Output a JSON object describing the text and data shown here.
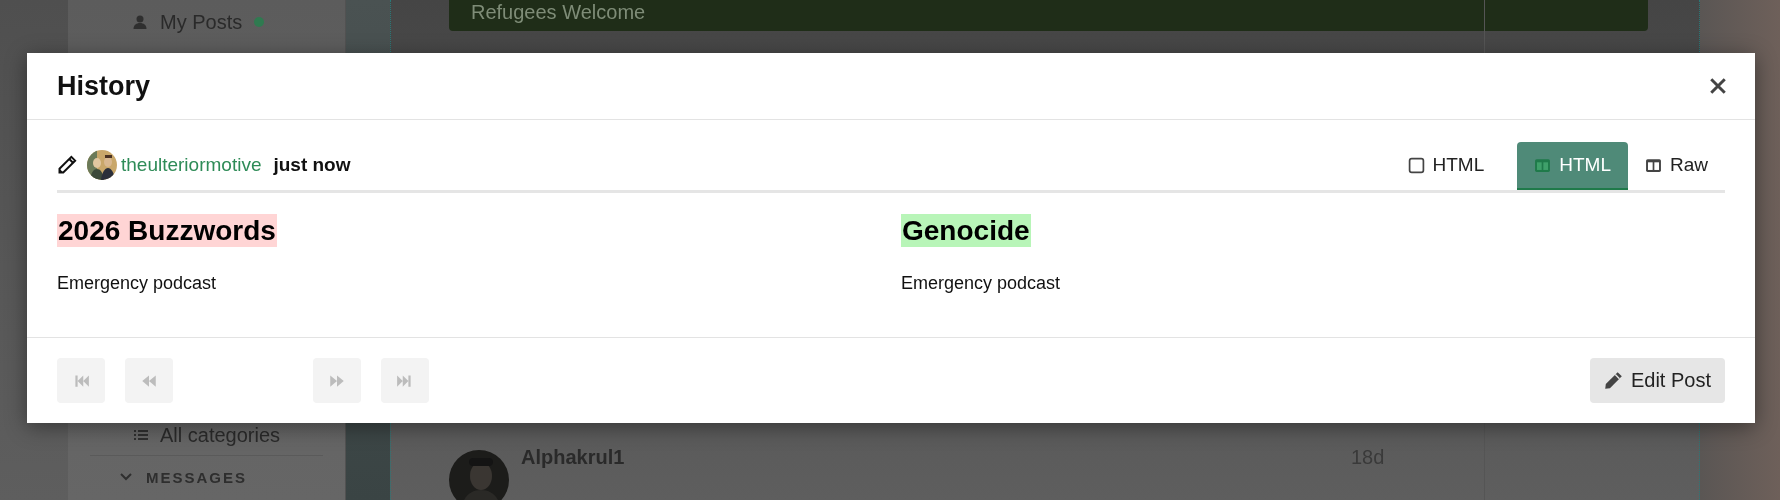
{
  "background": {
    "sidebar": {
      "items": [
        {
          "label": "My Posts",
          "kind": "person",
          "unread": true
        },
        {
          "label": "All categories",
          "kind": "list",
          "unread": false
        }
      ],
      "section": "MESSAGES"
    },
    "banner": "Refugees Welcome",
    "topic_row": {
      "user": "Alphakrul1",
      "age": "18d"
    }
  },
  "dialog": {
    "title": "History",
    "revision": {
      "user": "theulteriormotive",
      "time": "just now"
    },
    "view_tabs": [
      {
        "label": "HTML",
        "kind": "inline",
        "selected": false
      },
      {
        "label": "HTML",
        "kind": "side-by-side",
        "selected": true
      },
      {
        "label": "Raw",
        "kind": "side-by-side",
        "selected": false
      }
    ],
    "diff": [
      {
        "title": "2026 Buzzwords",
        "color": "#ffd5d5",
        "body": "Emergency podcast"
      },
      {
        "title": "Genocide",
        "color": "#b8f5b8",
        "body": "Emergency podcast"
      }
    ],
    "nav_buttons": [
      {
        "kind": "first",
        "disabled": true
      },
      {
        "kind": "previous",
        "disabled": true
      },
      {
        "kind": "next",
        "disabled": true
      },
      {
        "kind": "last",
        "disabled": true
      }
    ],
    "edit_button": "Edit Post"
  }
}
